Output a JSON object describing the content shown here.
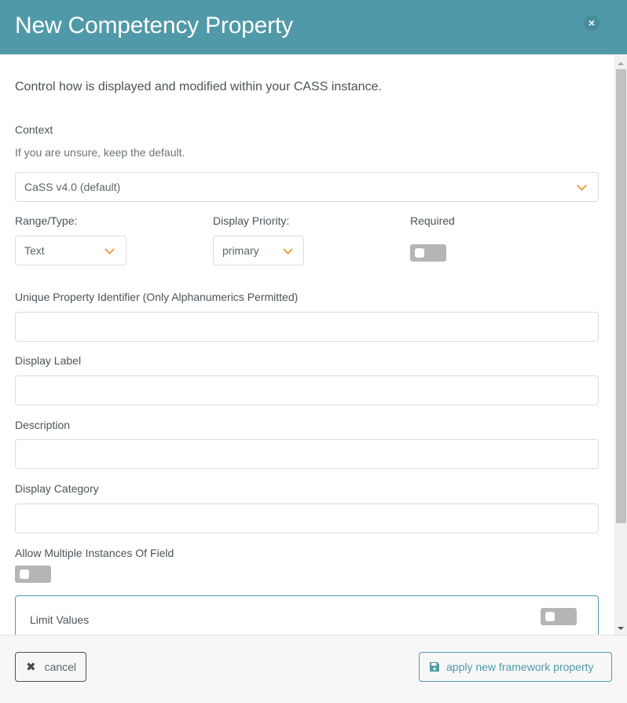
{
  "header": {
    "title": "New Competency Property",
    "close_icon": "×"
  },
  "body": {
    "intro": "Control how is displayed and modified within your CASS instance.",
    "context": {
      "label": "Context",
      "help": "If you are unsure, keep the default.",
      "selected": "CaSS v4.0 (default)"
    },
    "range_type": {
      "label": "Range/Type:",
      "selected": "Text"
    },
    "display_priority": {
      "label": "Display Priority:",
      "selected": "primary"
    },
    "required": {
      "label": "Required",
      "checked": false
    },
    "unique_id": {
      "label": "Unique Property Identifier (Only Alphanumerics Permitted)",
      "value": ""
    },
    "display_label": {
      "label": "Display Label",
      "value": ""
    },
    "description": {
      "label": "Description",
      "value": ""
    },
    "display_category": {
      "label": "Display Category",
      "value": ""
    },
    "allow_multiple": {
      "label": "Allow Multiple Instances Of Field",
      "checked": false
    },
    "limit_values": {
      "label": "Limit Values",
      "checked": false
    }
  },
  "footer": {
    "cancel_icon": "✖",
    "cancel_label": "cancel",
    "apply_label": "apply new framework property"
  },
  "colors": {
    "header": "#5099a8",
    "accent": "#5099a8",
    "chevron": "#e8a04a",
    "toggle_off": "#b5b5b5"
  }
}
